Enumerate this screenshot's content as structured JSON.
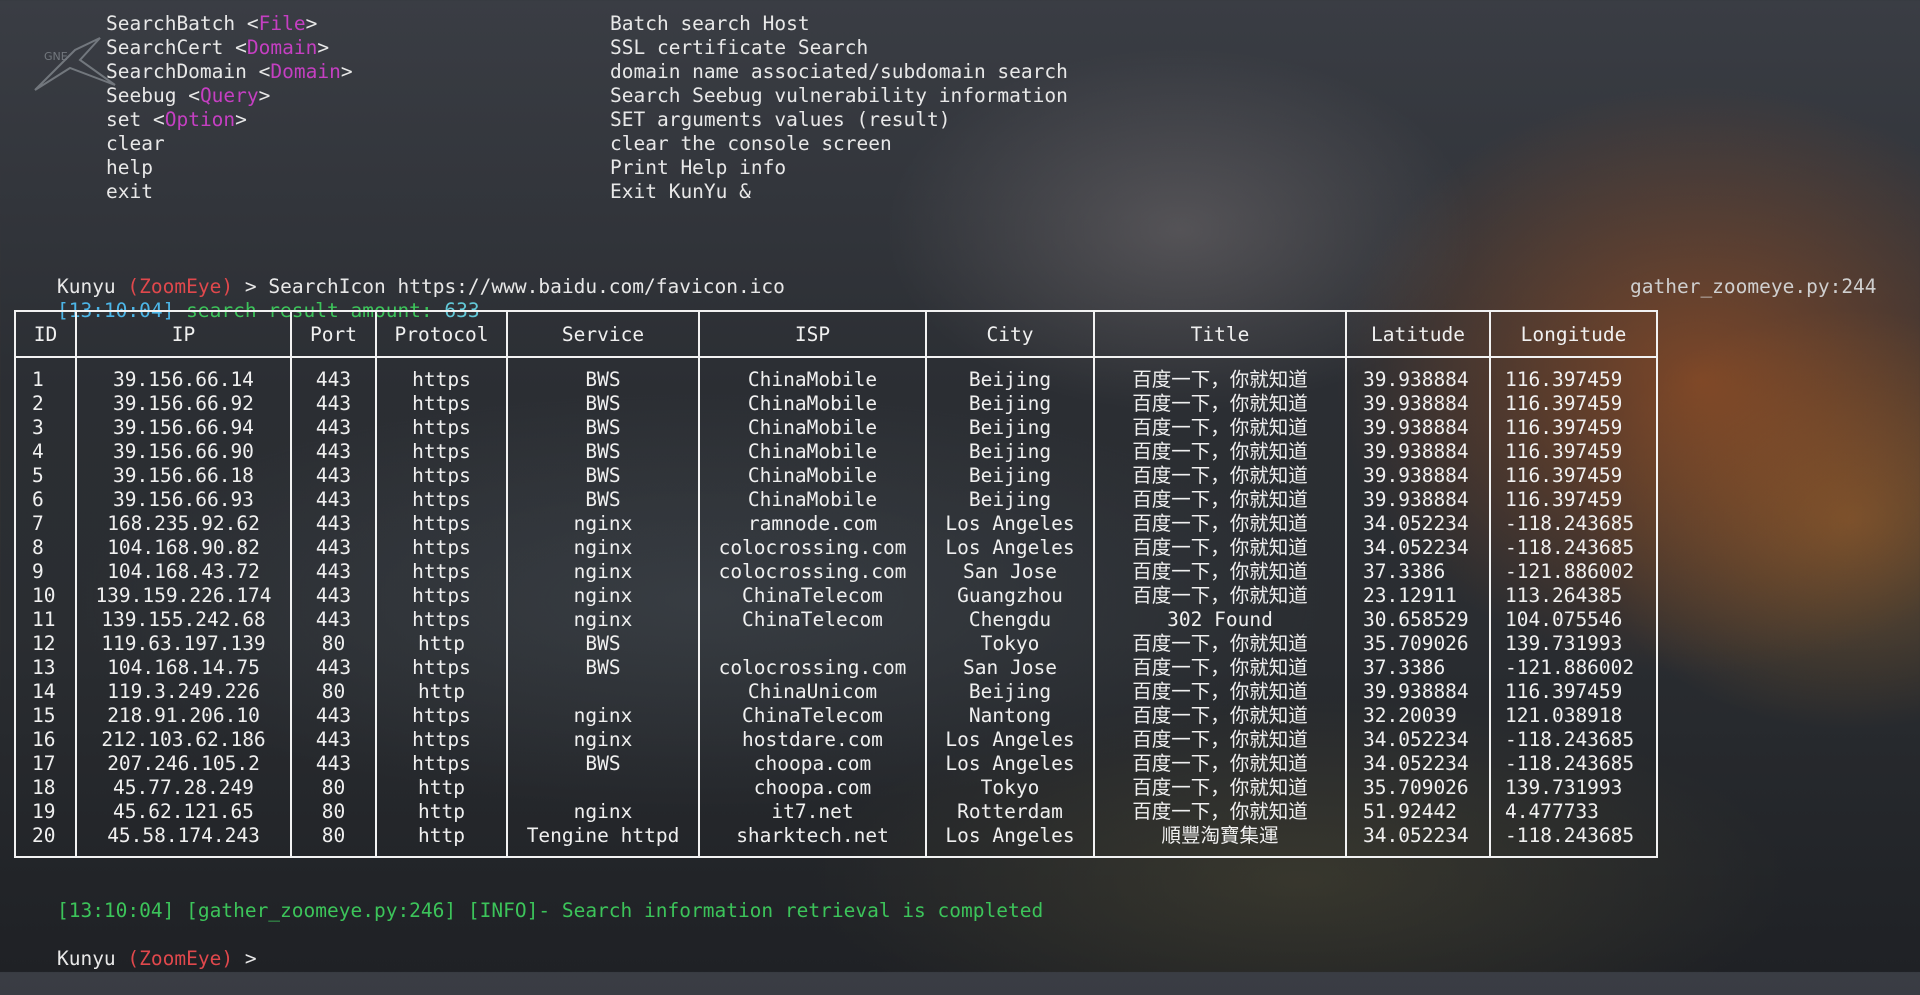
{
  "help": [
    {
      "cmd": "SearchBatch",
      "arg": "File",
      "desc": "Batch search Host"
    },
    {
      "cmd": "SearchCert",
      "arg": "Domain",
      "desc": "SSL certificate Search"
    },
    {
      "cmd": "SearchDomain",
      "arg": "Domain",
      "desc": "domain name associated/subdomain search"
    },
    {
      "cmd": "Seebug",
      "arg": "Query",
      "desc": "Search Seebug vulnerability information"
    },
    {
      "cmd": "set",
      "arg": "Option",
      "desc": "SET arguments values (result)"
    },
    {
      "cmd": "clear",
      "arg": "",
      "desc": "clear the console screen"
    },
    {
      "cmd": "help",
      "arg": "",
      "desc": "Print Help info"
    },
    {
      "cmd": "exit",
      "arg": "",
      "desc": "Exit KunYu &"
    }
  ],
  "prompt": {
    "name": "Kunyu",
    "module": "(ZoomEye)",
    "symbol": ">",
    "command": "SearchIcon https://www.baidu.com/favicon.ico"
  },
  "log1": {
    "time": "[13:10:04]",
    "label": "search result amount:",
    "count": "633",
    "source": "gather_zoomeye.py:244"
  },
  "table": {
    "headers": [
      "ID",
      "IP",
      "Port",
      "Protocol",
      "Service",
      "ISP",
      "City",
      "Title",
      "Latitude",
      "Longitude"
    ],
    "rows": [
      [
        "1",
        "39.156.66.14",
        "443",
        "https",
        "BWS",
        "ChinaMobile",
        "Beijing",
        "百度一下，你就知道",
        "39.938884",
        "116.397459"
      ],
      [
        "2",
        "39.156.66.92",
        "443",
        "https",
        "BWS",
        "ChinaMobile",
        "Beijing",
        "百度一下，你就知道",
        "39.938884",
        "116.397459"
      ],
      [
        "3",
        "39.156.66.94",
        "443",
        "https",
        "BWS",
        "ChinaMobile",
        "Beijing",
        "百度一下，你就知道",
        "39.938884",
        "116.397459"
      ],
      [
        "4",
        "39.156.66.90",
        "443",
        "https",
        "BWS",
        "ChinaMobile",
        "Beijing",
        "百度一下，你就知道",
        "39.938884",
        "116.397459"
      ],
      [
        "5",
        "39.156.66.18",
        "443",
        "https",
        "BWS",
        "ChinaMobile",
        "Beijing",
        "百度一下，你就知道",
        "39.938884",
        "116.397459"
      ],
      [
        "6",
        "39.156.66.93",
        "443",
        "https",
        "BWS",
        "ChinaMobile",
        "Beijing",
        "百度一下，你就知道",
        "39.938884",
        "116.397459"
      ],
      [
        "7",
        "168.235.92.62",
        "443",
        "https",
        "nginx",
        "ramnode.com",
        "Los Angeles",
        "百度一下，你就知道",
        "34.052234",
        "-118.243685"
      ],
      [
        "8",
        "104.168.90.82",
        "443",
        "https",
        "nginx",
        "colocrossing.com",
        "Los Angeles",
        "百度一下，你就知道",
        "34.052234",
        "-118.243685"
      ],
      [
        "9",
        "104.168.43.72",
        "443",
        "https",
        "nginx",
        "colocrossing.com",
        "San Jose",
        "百度一下，你就知道",
        "37.3386",
        "-121.886002"
      ],
      [
        "10",
        "139.159.226.174",
        "443",
        "https",
        "nginx",
        "ChinaTelecom",
        "Guangzhou",
        "百度一下，你就知道",
        "23.12911",
        "113.264385"
      ],
      [
        "11",
        "139.155.242.68",
        "443",
        "https",
        "nginx",
        "ChinaTelecom",
        "Chengdu",
        "302 Found",
        "30.658529",
        "104.075546"
      ],
      [
        "12",
        "119.63.197.139",
        "80",
        "http",
        "BWS",
        "",
        "Tokyo",
        "百度一下，你就知道",
        "35.709026",
        "139.731993"
      ],
      [
        "13",
        "104.168.14.75",
        "443",
        "https",
        "BWS",
        "colocrossing.com",
        "San Jose",
        "百度一下，你就知道",
        "37.3386",
        "-121.886002"
      ],
      [
        "14",
        "119.3.249.226",
        "80",
        "http",
        "",
        "ChinaUnicom",
        "Beijing",
        "百度一下，你就知道",
        "39.938884",
        "116.397459"
      ],
      [
        "15",
        "218.91.206.10",
        "443",
        "https",
        "nginx",
        "ChinaTelecom",
        "Nantong",
        "百度一下，你就知道",
        "32.20039",
        "121.038918"
      ],
      [
        "16",
        "212.103.62.186",
        "443",
        "https",
        "nginx",
        "hostdare.com",
        "Los Angeles",
        "百度一下，你就知道",
        "34.052234",
        "-118.243685"
      ],
      [
        "17",
        "207.246.105.2",
        "443",
        "https",
        "BWS",
        "choopa.com",
        "Los Angeles",
        "百度一下，你就知道",
        "34.052234",
        "-118.243685"
      ],
      [
        "18",
        "45.77.28.249",
        "80",
        "http",
        "",
        "choopa.com",
        "Tokyo",
        "百度一下，你就知道",
        "35.709026",
        "139.731993"
      ],
      [
        "19",
        "45.62.121.65",
        "80",
        "http",
        "nginx",
        "it7.net",
        "Rotterdam",
        "百度一下，你就知道",
        "51.92442",
        "4.477733"
      ],
      [
        "20",
        "45.58.174.243",
        "80",
        "http",
        "Tengine httpd",
        "sharktech.net",
        "Los Angeles",
        "順豐淘寶集運",
        "34.052234",
        "-118.243685"
      ]
    ]
  },
  "log2": {
    "time": "[13:10:04]",
    "source": "[gather_zoomeye.py:246]",
    "level": "[INFO]-",
    "message": "Search information retrieval is completed"
  },
  "prompt2": {
    "name": "Kunyu",
    "module": "(ZoomEye)",
    "symbol": ">"
  },
  "logo_text": "GNE"
}
